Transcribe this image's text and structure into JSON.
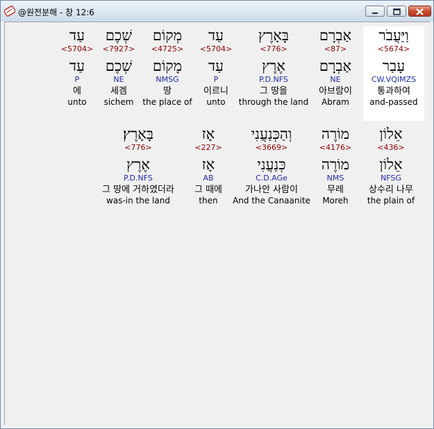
{
  "window": {
    "title": "@원전분해 - 창 12:6"
  },
  "rows": [
    [
      {
        "hebrew": "עַד",
        "strong": "<5704>",
        "lemma": "עַד",
        "morph": "P",
        "korean": "에",
        "english": "unto"
      },
      {
        "hebrew": "שְׁכֶם",
        "strong": "<7927>",
        "lemma": "שְׁכֶם",
        "morph": "NE",
        "korean": "세겜",
        "english": "sichem"
      },
      {
        "hebrew": "מְקוֹם",
        "strong": "<4725>",
        "lemma": "מָקוֹם",
        "morph": "NMSG",
        "korean": "땅",
        "english": "the place of"
      },
      {
        "hebrew": "עַד",
        "strong": "<5704>",
        "lemma": "עַד",
        "morph": "P",
        "korean": "이르니",
        "english": "unto"
      },
      {
        "hebrew": "בָּאָרֶץ",
        "strong": "<776>",
        "lemma": "אֶרֶץ",
        "morph": "P.D.NFS",
        "korean": "그 땅을",
        "english": "through the land"
      },
      {
        "hebrew": "אַבְרָם",
        "strong": "<87>",
        "lemma": "אַבְרָם",
        "morph": "NE",
        "korean": "아브람이",
        "english": "Abram"
      },
      {
        "hebrew": "וַיַּעֲבֹר",
        "strong": "<5674>",
        "lemma": "עָבַר",
        "morph": "CW.VQIMZS",
        "korean": "통과하여",
        "english": "and-passed",
        "selected": true
      }
    ],
    [
      {
        "hebrew": "בָּאָרֶץ׃",
        "strong": "<776>",
        "lemma": "אֶרֶץ",
        "morph": "P.D.NFS",
        "korean": "그 땅에 거하였더라",
        "english": "was-in the land"
      },
      {
        "hebrew": "אָז",
        "strong": "<227>",
        "lemma": "אָז",
        "morph": "AB",
        "korean": "그 때에",
        "english": "then"
      },
      {
        "hebrew": "וְהַכְּנַעֲנִי",
        "strong": "<3669>",
        "lemma": "כְּנַעֲנִי",
        "morph": "C.D.AGe",
        "korean": "가나안 사람이",
        "english": "And the Canaanite"
      },
      {
        "hebrew": "מוֹרֶה",
        "strong": "<4176>",
        "lemma": "מוֹרֶה",
        "morph": "NMS",
        "korean": "무레",
        "english": "Moreh"
      },
      {
        "hebrew": "אֵלוֹן",
        "strong": "<436>",
        "lemma": "אֵלוֹן",
        "morph": "NFSG",
        "korean": "상수리 나무",
        "english": "the plain of"
      }
    ]
  ]
}
